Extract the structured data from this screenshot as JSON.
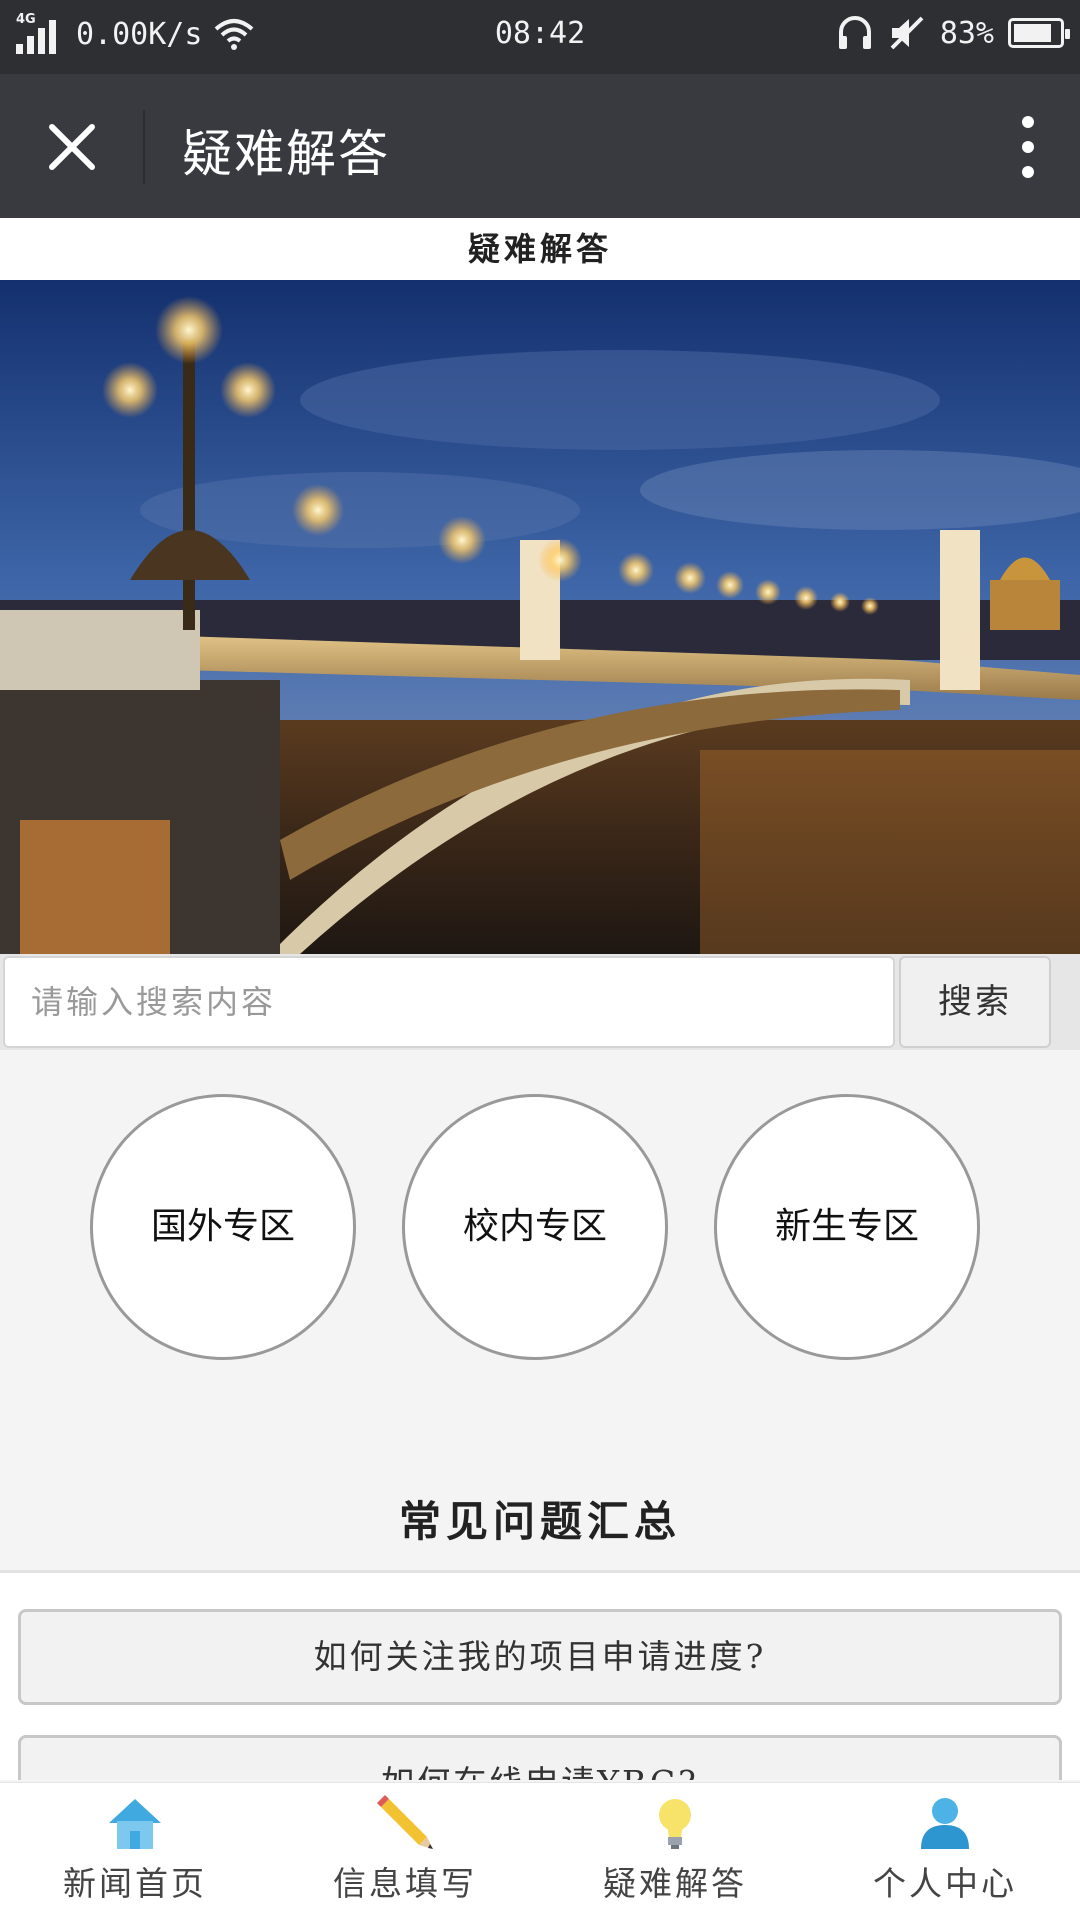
{
  "status_bar": {
    "network": "4G",
    "speed": "0.00K/s",
    "time": "08:42",
    "battery": "83%",
    "battery_level": 0.83
  },
  "title_bar": {
    "title": "疑难解答",
    "close_icon": "close-icon",
    "more_icon": "more-vertical-icon"
  },
  "page_heading": "疑难解答",
  "search": {
    "placeholder": "请输入搜索内容",
    "button_label": "搜索"
  },
  "zones": [
    {
      "label": "国外专区"
    },
    {
      "label": "校内专区"
    },
    {
      "label": "新生专区"
    }
  ],
  "faq": {
    "heading": "常见问题汇总",
    "items": [
      {
        "label": "如何关注我的项目申请进度?"
      },
      {
        "label": "如何在线申请YBC?"
      }
    ]
  },
  "bottom_nav": [
    {
      "label": "新闻首页",
      "icon": "home-icon"
    },
    {
      "label": "信息填写",
      "icon": "pencil-icon"
    },
    {
      "label": "疑难解答",
      "icon": "lightbulb-icon"
    },
    {
      "label": "个人中心",
      "icon": "user-icon"
    }
  ],
  "colors": {
    "status_bar_bg": "#2d2f33",
    "title_bar_bg": "#393a3f",
    "page_bg": "#f4f4f4"
  }
}
